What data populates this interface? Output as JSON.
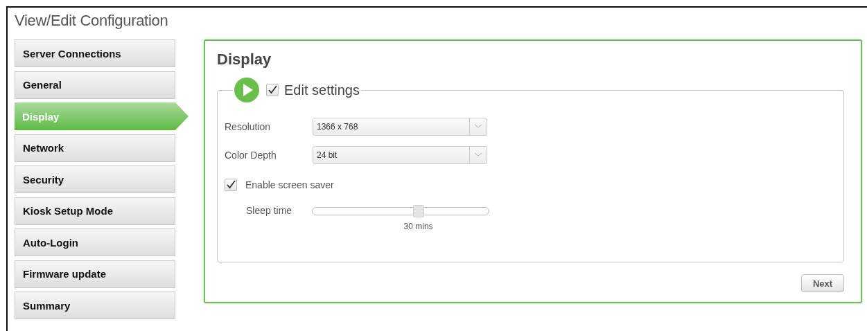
{
  "window": {
    "title": "View/Edit Configuration"
  },
  "sidebar": {
    "items": [
      {
        "label": "Server Connections",
        "selected": false
      },
      {
        "label": "General",
        "selected": false
      },
      {
        "label": "Display",
        "selected": true
      },
      {
        "label": "Network",
        "selected": false
      },
      {
        "label": "Security",
        "selected": false
      },
      {
        "label": "Kiosk Setup Mode",
        "selected": false
      },
      {
        "label": "Auto-Login",
        "selected": false
      },
      {
        "label": "Firmware update",
        "selected": false
      },
      {
        "label": "Summary",
        "selected": false
      }
    ]
  },
  "panel": {
    "title": "Display",
    "section": {
      "legend": "Edit settings",
      "checked": true,
      "fields": [
        {
          "label": "Resolution",
          "value": "1366 x 768"
        },
        {
          "label": "Color Depth",
          "value": "24 bit"
        }
      ],
      "screen_saver": {
        "label": "Enable screen saver",
        "checked": true
      },
      "sleep_time": {
        "label": "Sleep time",
        "level": 0.6,
        "reading": "30 mins"
      }
    },
    "buttons": [
      "Next"
    ]
  }
}
